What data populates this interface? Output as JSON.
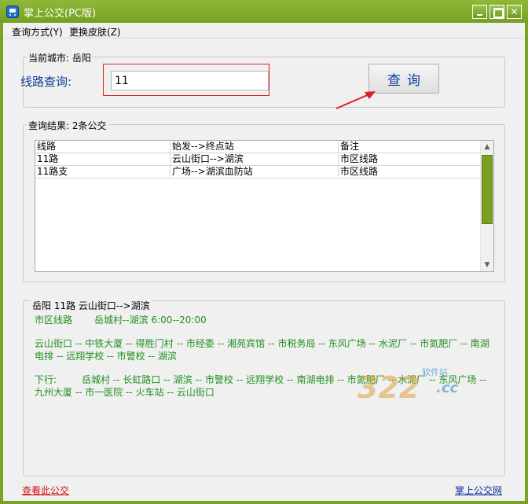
{
  "window": {
    "title": "掌上公交(PC版)"
  },
  "menu": {
    "query_mode": "查询方式(Y)",
    "change_skin": "更换皮肤(Z)"
  },
  "search": {
    "current_city": "当前城市: 岳阳",
    "route_label": "线路查询:",
    "route_value": "11",
    "button_label": "查询"
  },
  "results": {
    "title": "查询结果: 2条公交",
    "columns": [
      "线路",
      "始发-->终点站",
      "备注"
    ],
    "rows": [
      [
        "11路",
        "云山街口-->湖滨",
        "市区线路"
      ],
      [
        "11路支",
        "广场-->湖滨血防站",
        "市区线路"
      ]
    ]
  },
  "detail": {
    "header": "岳阳 11路    云山街口-->湖滨",
    "type_line": "市区线路",
    "hours_line": "岳城村--湖滨 6:00--20:00",
    "up_stops": "云山街口 -- 中铁大厦 -- 得胜门村 -- 市经委 -- 湘苑宾馆 -- 市税务局 -- 东风广场 -- 水泥厂 -- 市氮肥厂 -- 南湖电排 -- 远翔学校 -- 市警校 -- 湖滨",
    "down_label": "下行:",
    "down_stops": "岳城村 -- 长虹路口 -- 湖滨 -- 市警校 -- 远翔学校 -- 南湖电排 -- 市氮肥厂 -- 水泥厂 -- 东风广场 -- 九州大厦 -- 市一医院 -- 火车站 -- 云山街口"
  },
  "watermark": {
    "big": "322",
    "small": "软件站",
    "cc": ".cc"
  },
  "footer": {
    "view_link": "查看此公交",
    "site_link": "掌上公交网"
  }
}
